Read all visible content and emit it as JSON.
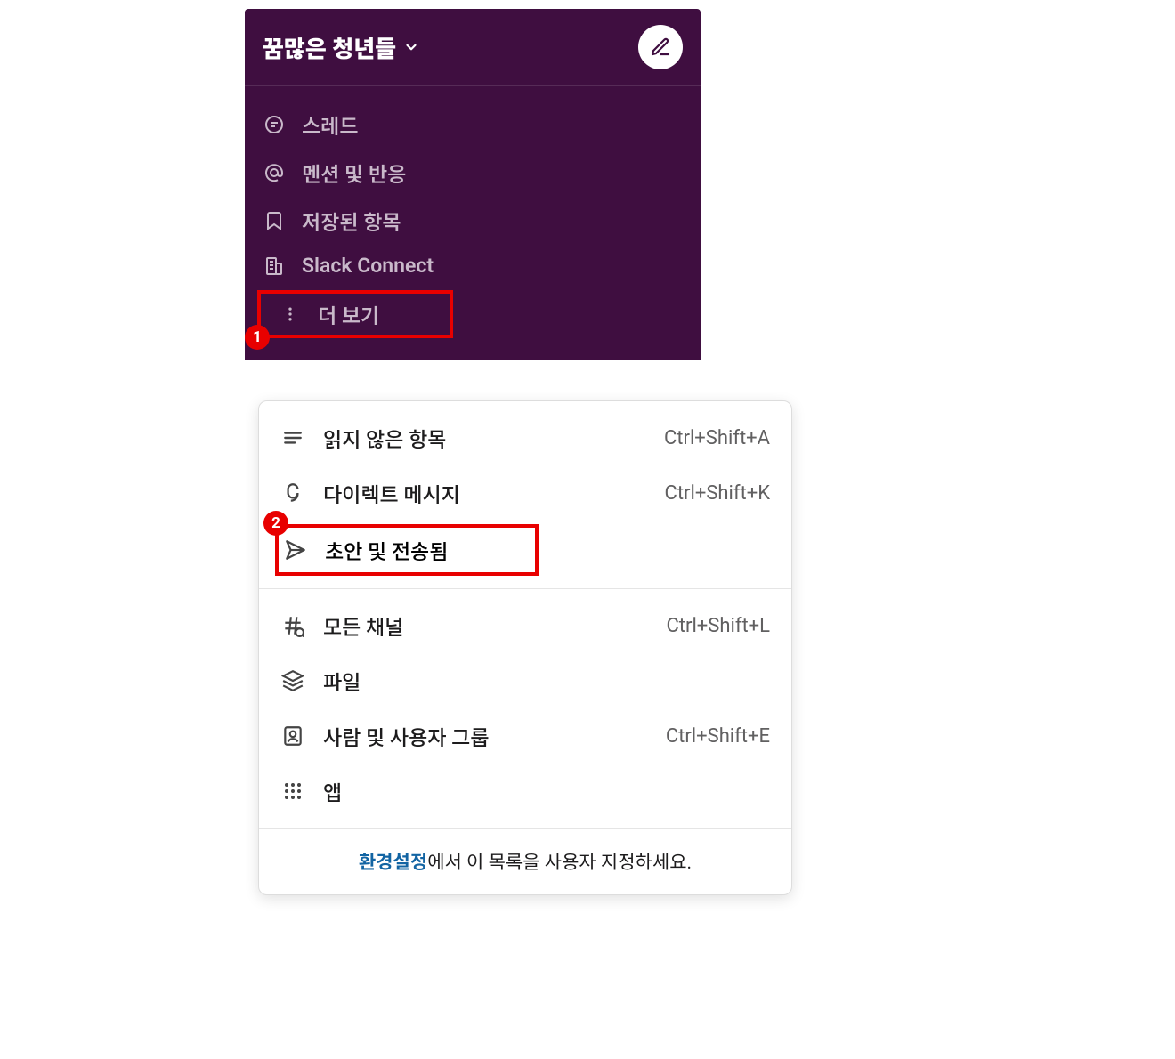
{
  "header": {
    "workspace_name": "꿈많은 청년들"
  },
  "sidebar": {
    "items": [
      {
        "label": "스레드",
        "icon": "threads-icon"
      },
      {
        "label": "멘션 및 반응",
        "icon": "at-icon"
      },
      {
        "label": "저장된 항목",
        "icon": "bookmark-icon"
      },
      {
        "label": "Slack Connect",
        "icon": "building-icon"
      },
      {
        "label": "더 보기",
        "icon": "more-icon"
      }
    ]
  },
  "annotations": {
    "badge1": "1",
    "badge2": "2"
  },
  "popup": {
    "group1": [
      {
        "label": "읽지 않은 항목",
        "shortcut": "Ctrl+Shift+A",
        "icon": "unread-icon"
      },
      {
        "label": "다이렉트 메시지",
        "shortcut": "Ctrl+Shift+K",
        "icon": "dm-icon"
      },
      {
        "label": "초안 및 전송됨",
        "shortcut": "",
        "icon": "send-icon"
      }
    ],
    "group2": [
      {
        "label": "모든 채널",
        "shortcut": "Ctrl+Shift+L",
        "icon": "hash-icon"
      },
      {
        "label": "파일",
        "shortcut": "",
        "icon": "files-icon"
      },
      {
        "label": "사람 및 사용자 그룹",
        "shortcut": "Ctrl+Shift+E",
        "icon": "people-icon"
      },
      {
        "label": "앱",
        "shortcut": "",
        "icon": "apps-icon"
      }
    ],
    "footer_link": "환경설정",
    "footer_text": "에서 이 목록을 사용자 지정하세요."
  }
}
